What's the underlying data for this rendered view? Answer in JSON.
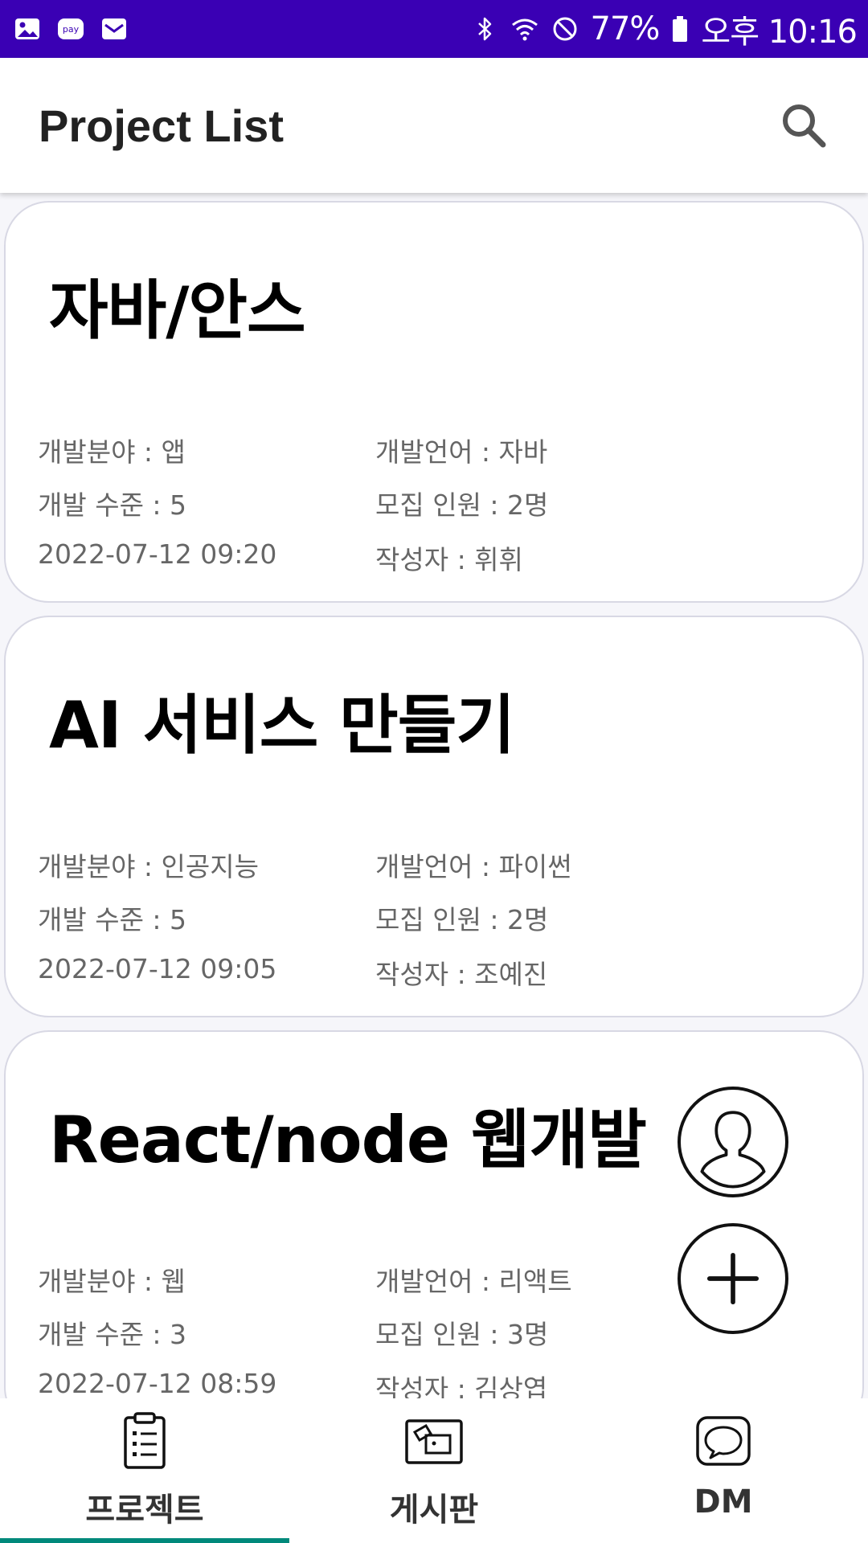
{
  "status_bar": {
    "pay_label": "pay",
    "battery": "77%",
    "time": "오후 10:16"
  },
  "app_bar": {
    "title": "Project List"
  },
  "projects": [
    {
      "title": "자바/안스",
      "field": "개발분야 : 앱",
      "language": "개발언어 : 자바",
      "level": "개발 수준 : 5",
      "recruit": "모집 인원 : 2명",
      "date": "2022-07-12 09:20",
      "author": "작성자 : 휘휘"
    },
    {
      "title": "AI 서비스 만들기",
      "field": "개발분야 : 인공지능",
      "language": "개발언어 : 파이썬",
      "level": "개발 수준 : 5",
      "recruit": "모집 인원 : 2명",
      "date": "2022-07-12 09:05",
      "author": "작성자 : 조예진"
    },
    {
      "title": "React/node 웹개발",
      "field": "개발분야 : 웹",
      "language": "개발언어 : 리액트",
      "level": "개발 수준 : 3",
      "recruit": "모집 인원 : 3명",
      "date": "2022-07-12 08:59",
      "author": "작성자 : 김상엽"
    }
  ],
  "bottom_nav": {
    "items": [
      {
        "label": "프로젝트",
        "icon": "clipboard-list-icon",
        "active": true
      },
      {
        "label": "게시판",
        "icon": "board-icon",
        "active": false
      },
      {
        "label": "DM",
        "icon": "chat-bubble-icon",
        "active": false
      }
    ],
    "accent_color": "#00897b"
  },
  "colors": {
    "status_bar": "#3a00b4",
    "card_border": "#d8d8e4",
    "text_secondary": "#666666"
  }
}
